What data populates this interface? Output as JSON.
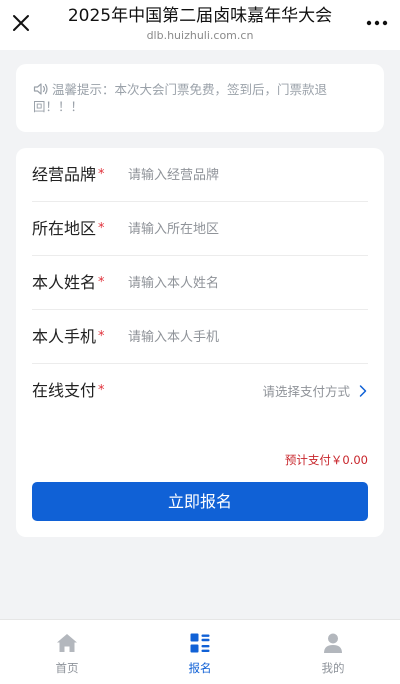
{
  "header": {
    "title": "2025年中国第二届卤味嘉年华大会",
    "domain": "dlb.huizhuli.com.cn"
  },
  "notice": {
    "text": "温馨提示：本次大会门票免费，签到后，门票款退回！！！"
  },
  "form": {
    "required_mark": "*",
    "fields": [
      {
        "label": "经营品牌",
        "placeholder": "请输入经营品牌"
      },
      {
        "label": "所在地区",
        "placeholder": "请输入所在地区"
      },
      {
        "label": "本人姓名",
        "placeholder": "请输入本人姓名"
      },
      {
        "label": "本人手机",
        "placeholder": "请输入本人手机"
      }
    ],
    "payment": {
      "label": "在线支付",
      "placeholder": "请选择支付方式"
    },
    "total": "预计支付￥0.00",
    "submit_label": "立即报名"
  },
  "tabbar": {
    "items": [
      {
        "label": "首页",
        "icon": "home-icon",
        "active": false
      },
      {
        "label": "报名",
        "icon": "grid-list-icon",
        "active": true
      },
      {
        "label": "我的",
        "icon": "user-icon",
        "active": false
      }
    ]
  },
  "colors": {
    "accent": "#1061d6",
    "required": "#e0303a",
    "price": "#c8252b",
    "background": "#f2f3f5"
  }
}
